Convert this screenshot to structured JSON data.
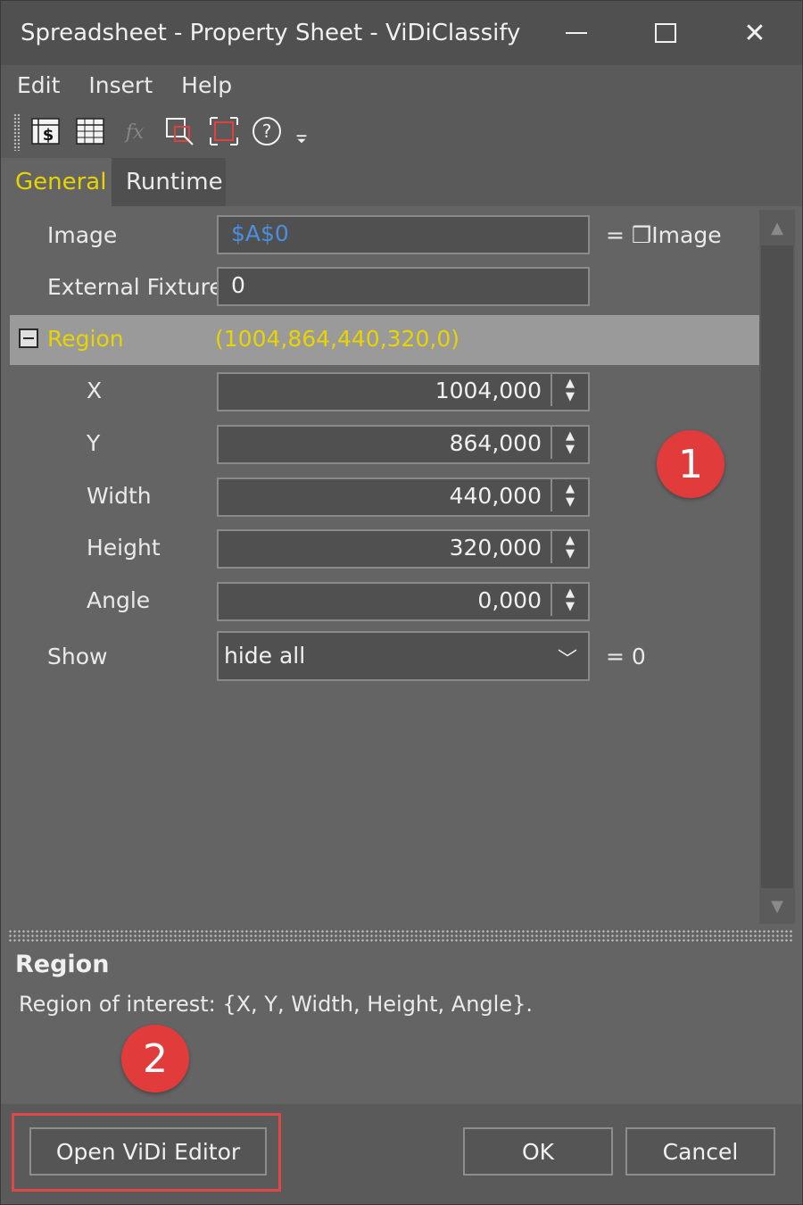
{
  "window": {
    "title": "Spreadsheet - Property Sheet - ViDiClassify"
  },
  "menu": {
    "items": [
      "Edit",
      "Insert",
      "Help"
    ]
  },
  "tabs": {
    "general": "General",
    "runtime": "Runtime"
  },
  "properties": {
    "image": {
      "label": "Image",
      "value": "$A$0",
      "result": "= ❒Image"
    },
    "external_fixture": {
      "label": "External Fixture",
      "value": "0"
    },
    "region": {
      "label": "Region",
      "value": "(1004,864,440,320,0)"
    },
    "x": {
      "label": "X",
      "value": "1004,000"
    },
    "y": {
      "label": "Y",
      "value": "864,000"
    },
    "width": {
      "label": "Width",
      "value": "440,000"
    },
    "height": {
      "label": "Height",
      "value": "320,000"
    },
    "angle": {
      "label": "Angle",
      "value": "0,000"
    },
    "show": {
      "label": "Show",
      "value": "hide all",
      "result": "= 0"
    }
  },
  "description": {
    "title": "Region",
    "text": "Region of interest: {X, Y, Width, Height, Angle}."
  },
  "buttons": {
    "open_vidi": "Open ViDi Editor",
    "ok": "OK",
    "cancel": "Cancel"
  },
  "callouts": {
    "one": "1",
    "two": "2"
  },
  "colors": {
    "accent_yellow": "#e8d400",
    "link_blue": "#4a8fe0",
    "callout_red": "#e23b3b"
  }
}
